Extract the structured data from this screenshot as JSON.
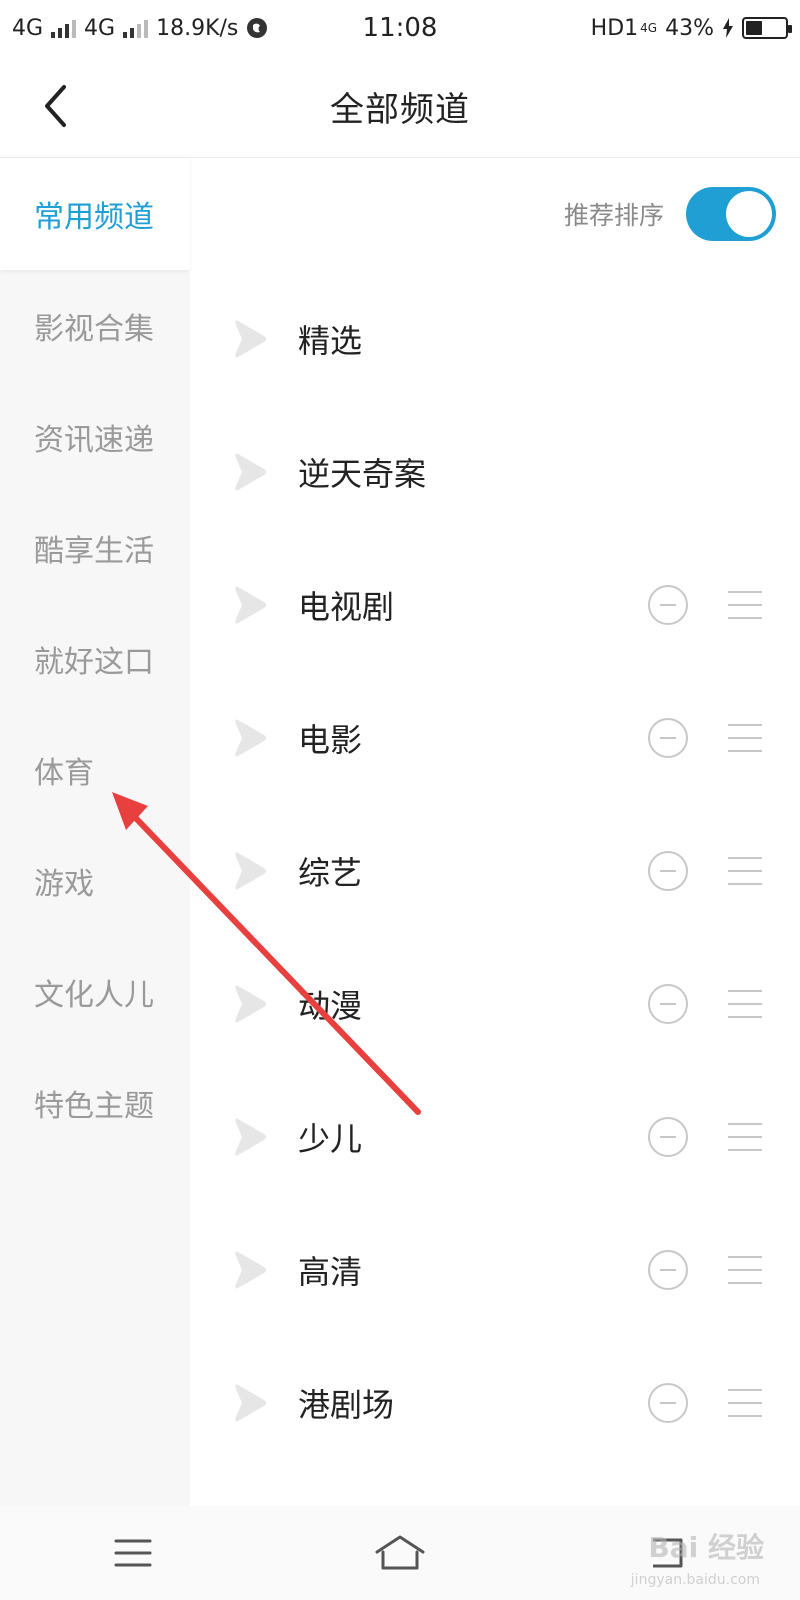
{
  "status_bar": {
    "network1": "4G",
    "network2": "4G",
    "speed": "18.9K/s",
    "time": "11:08",
    "hd": "HD1",
    "hd_sub": "4G",
    "battery": "43%",
    "battery_level": 0.43
  },
  "header": {
    "title": "全部频道",
    "back_icon": "chevron-left-icon"
  },
  "sort": {
    "label": "推荐排序",
    "enabled": true,
    "accent_color": "#1f9fd3"
  },
  "sidebar": {
    "items": [
      {
        "label": "常用频道",
        "active": true
      },
      {
        "label": "影视合集",
        "active": false
      },
      {
        "label": "资讯速递",
        "active": false
      },
      {
        "label": "酷享生活",
        "active": false
      },
      {
        "label": "就好这口",
        "active": false
      },
      {
        "label": "体育",
        "active": false
      },
      {
        "label": "游戏",
        "active": false
      },
      {
        "label": "文化人儿",
        "active": false
      },
      {
        "label": "特色主题",
        "active": false
      }
    ]
  },
  "channels": [
    {
      "label": "精选",
      "editable": false
    },
    {
      "label": "逆天奇案",
      "editable": false
    },
    {
      "label": "电视剧",
      "editable": true
    },
    {
      "label": "电影",
      "editable": true
    },
    {
      "label": "综艺",
      "editable": true
    },
    {
      "label": "动漫",
      "editable": true
    },
    {
      "label": "少儿",
      "editable": true
    },
    {
      "label": "高清",
      "editable": true
    },
    {
      "label": "港剧场",
      "editable": true
    }
  ],
  "bottom_nav": {
    "items": [
      "menu-icon",
      "home-icon",
      "back-icon"
    ]
  },
  "watermark": {
    "text": "Bai 经验",
    "sub": "jingyan.baidu.com"
  },
  "annotation_color": "#e8403e"
}
